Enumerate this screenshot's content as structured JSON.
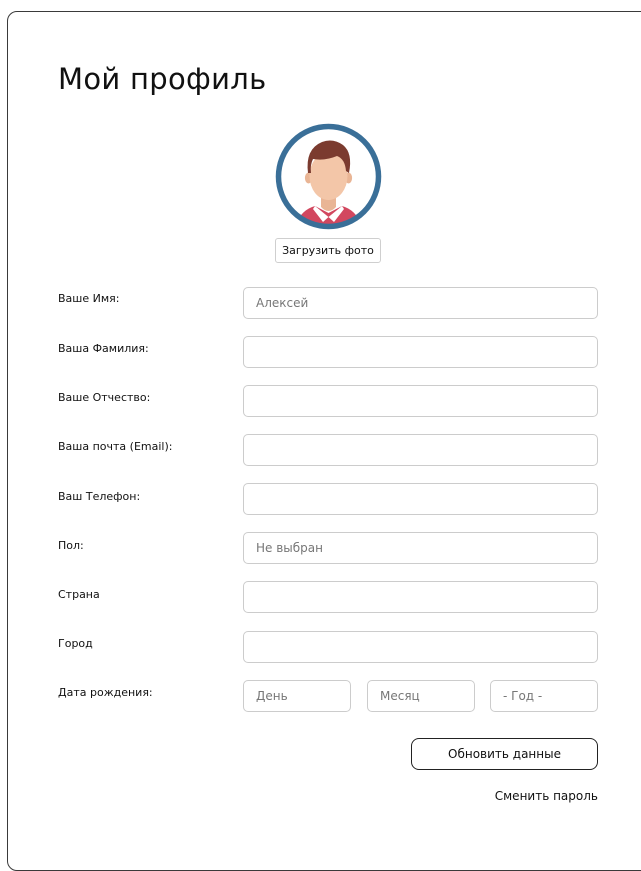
{
  "page": {
    "title": "Мой профиль"
  },
  "avatar": {
    "upload_label": "Загрузить фото",
    "icon": "user-avatar-icon",
    "ring_color": "#3a6f98"
  },
  "form": {
    "first_name": {
      "label": "Ваше Имя:",
      "placeholder": "Алексей",
      "value": ""
    },
    "last_name": {
      "label": "Ваша Фамилия:",
      "placeholder": "",
      "value": ""
    },
    "patronymic": {
      "label": "Ваше Отчество:",
      "placeholder": "",
      "value": ""
    },
    "email": {
      "label": "Ваша почта (Email):",
      "placeholder": "",
      "value": ""
    },
    "phone": {
      "label": "Ваш Телефон:",
      "placeholder": "",
      "value": ""
    },
    "gender": {
      "label": "Пол:",
      "placeholder": "Не выбран",
      "value": ""
    },
    "country": {
      "label": "Страна",
      "placeholder": "",
      "value": ""
    },
    "city": {
      "label": "Город",
      "placeholder": "",
      "value": ""
    },
    "birthdate": {
      "label": "Дата рождения:",
      "day_placeholder": "День",
      "month_placeholder": "Месяц",
      "year_placeholder": "- Год -"
    }
  },
  "actions": {
    "update_label": "Обновить данные",
    "change_password_label": "Сменить пароль"
  }
}
